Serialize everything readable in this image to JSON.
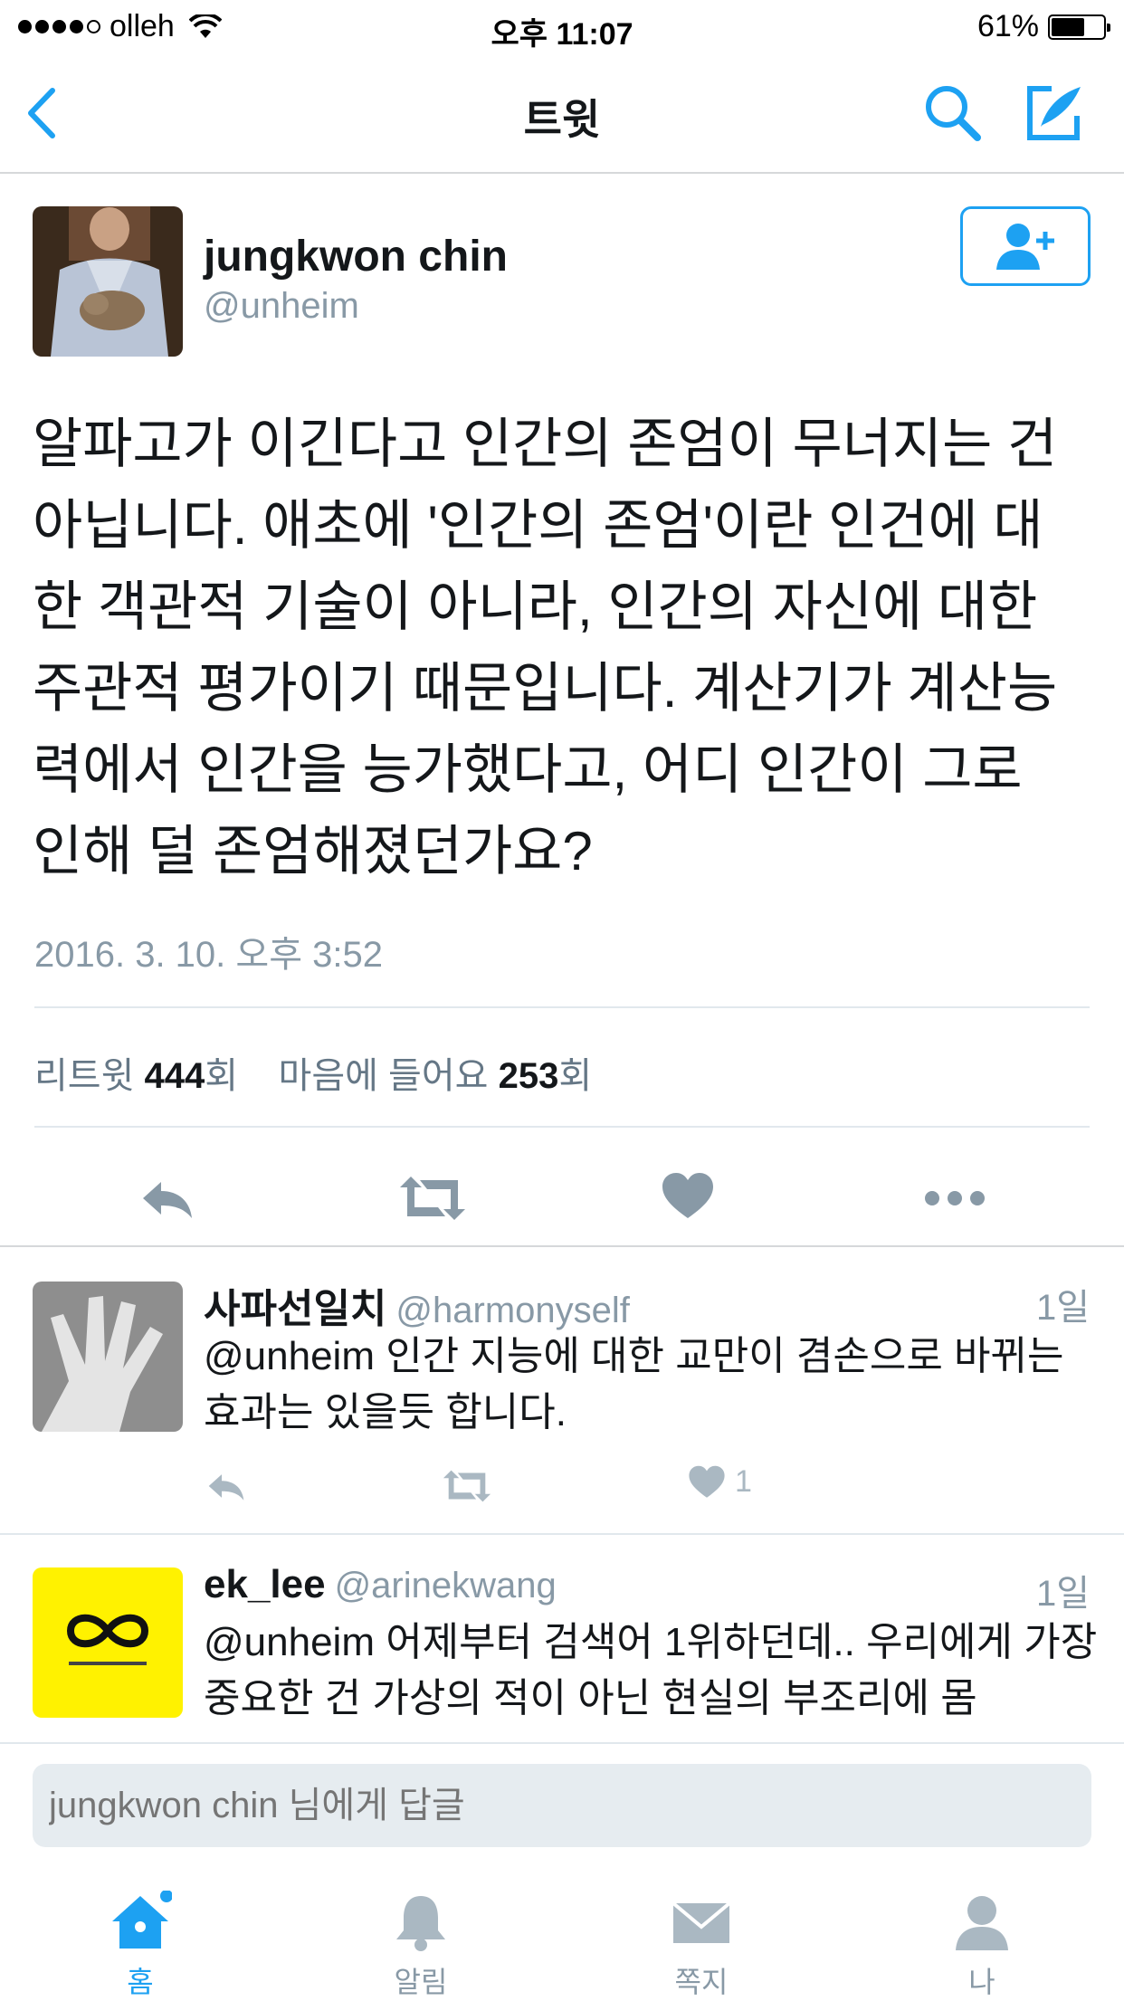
{
  "status_bar": {
    "carrier": "olleh",
    "time": "오후 11:07",
    "battery": "61%"
  },
  "nav": {
    "title": "트윗"
  },
  "tweet": {
    "author_name": "jungkwon chin",
    "author_handle": "@unheim",
    "text": "알파고가 이긴다고 인간의 존엄이 무너지는 건\n아닙니다. 애초에 '인간의 존엄'이란 인건에 대\n한 객관적 기술이 아니라, 인간의 자신에 대한\n주관적 평가이기 때문입니다. 계산기가 계산능\n력에서 인간을 능가했다고, 어디 인간이 그로\n인해 덜 존엄해졌던가요?",
    "timestamp": "2016. 3. 10. 오후 3:52",
    "retweet_label": "리트윗",
    "retweet_count": "444",
    "like_label": "마음에 들어요",
    "like_count": "253",
    "count_suffix": "회"
  },
  "replies": [
    {
      "name": "사파선일치",
      "handle": "@harmonyself",
      "age": "1일",
      "text": "@unheim 인간 지능에 대한 교만이 겸손으로 바뀌는 효과는 있을듯 합니다.",
      "like_count": "1"
    },
    {
      "name": "ek_lee",
      "handle": "@arinekwang",
      "age": "1일",
      "text": "@unheim 어제부터 검색어 1위하던데.. 우리에게 가장 중요한 건 가상의 적이 아닌 현실의 부조리에 몸",
      "like_count": ""
    }
  ],
  "composer": {
    "placeholder": "jungkwon chin 님에게 답글"
  },
  "tabs": [
    {
      "label": "홈"
    },
    {
      "label": "알림"
    },
    {
      "label": "쪽지"
    },
    {
      "label": "나"
    }
  ],
  "colors": {
    "accent": "#1da1f2",
    "icon_gray": "#8899a6",
    "divider": "#e1e8ed"
  }
}
